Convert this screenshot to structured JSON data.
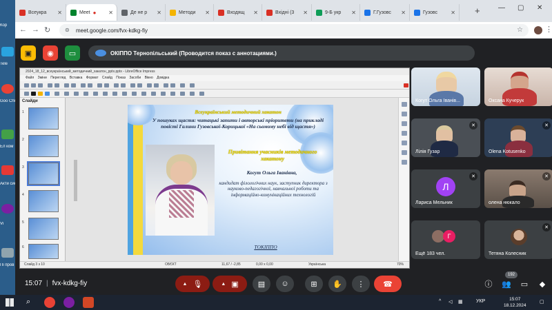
{
  "desktop": {
    "labels": [
      "Кор",
      "Tele",
      "Goo Chr",
      "Ел ком",
      "Акти сист",
      "Vi",
      "Пі пров"
    ]
  },
  "browser": {
    "tabs": [
      {
        "title": "Всеукра",
        "color": "#d93025"
      },
      {
        "title": "Meet",
        "color": "#00832d"
      },
      {
        "title": "Де не р",
        "color": "#5f6368"
      },
      {
        "title": "Методи",
        "color": "#f4b400"
      },
      {
        "title": "Входящ",
        "color": "#d93025"
      },
      {
        "title": "Вхідні (3",
        "color": "#d93025"
      },
      {
        "title": "9-Б укр",
        "color": "#0f9d58"
      },
      {
        "title": "Г.Гузовс",
        "color": "#1a73e8"
      },
      {
        "title": "Гузовс",
        "color": "#1a73e8"
      }
    ],
    "url": "meet.google.com/fvx-kdkg-fiy"
  },
  "meet": {
    "presenter_banner": "ОКІППО Тернопільський (Проводится показ с аннотациями.)",
    "meeting_code": "fvx-kdkg-fiy",
    "time": "15:07",
    "participant_count_badge": "192"
  },
  "libreoffice": {
    "title": "2024_18_12_всеукраїнський_методичний_хакатон_pptx.pptx - LibreOffice Impress",
    "menu": "Файл  Зміни  Перегляд  Вставка  Формат  Слайд  Показ  Засоби  Вікно  Довідка",
    "slides_pane_header": "Слайди",
    "thumb_numbers": [
      "1",
      "2",
      "3",
      "4",
      "5",
      "6"
    ],
    "status": {
      "slide": "Слайд 3 з 10",
      "obj": "ОБЄКТ",
      "coords": "11,67 / -2,85",
      "size": "0,00 x 0,00",
      "lang": "Українська",
      "zoom": "70%"
    }
  },
  "slide": {
    "header": "Всеукраїнський методичний хакатон",
    "subtitle": "У пошуках щастя: читацькі запити і авторські пріоритети (на прикладі повісті Галини Гузовської-Корицької «На сьомому небі від щастя»)",
    "greeting": "Привітання учасників методичного хакатону",
    "name": "Когут Ольга Іванівна,",
    "bio": "кандидат філологічних наук, заступник директора з науково-педагогічної, навчальної роботи та інформаційно-комунікаційних технологій",
    "org": "ТОКІППО"
  },
  "participants": [
    {
      "name": "Когут Ольга Іванів..."
    },
    {
      "name": "Оксана Кучерук"
    },
    {
      "name": "Лілія Гузар"
    },
    {
      "name": "Olena Kotusenko"
    },
    {
      "name": "Лариса Мельник",
      "initial": "Л"
    },
    {
      "name": "олена нюкало"
    },
    {
      "name": "Ещё 183 чел.",
      "initial": "Г"
    },
    {
      "name": "Тетяна Колесник"
    }
  ],
  "taskbar": {
    "lang": "УКР",
    "time": "15:07",
    "date": "18.12.2024"
  },
  "colors": {
    "meet_bg": "#202124",
    "end_call": "#ea4335",
    "mic_off": "#8c1c13"
  }
}
